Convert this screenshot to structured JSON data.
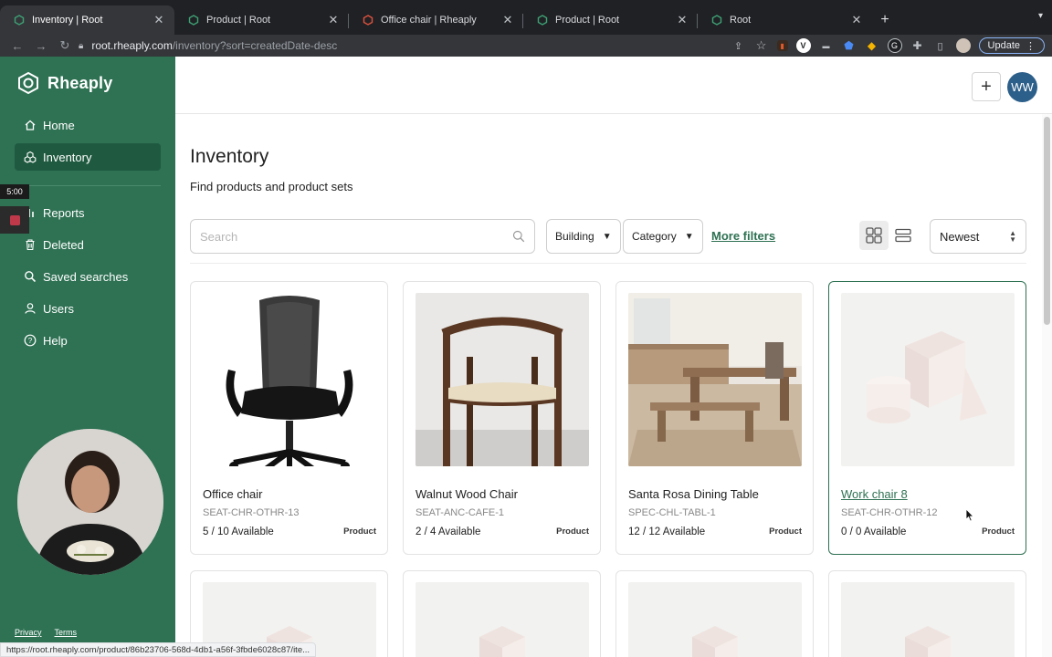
{
  "browser": {
    "tabs": [
      {
        "title": "Inventory | Root",
        "active": true
      },
      {
        "title": "Product | Root",
        "active": false
      },
      {
        "title": "Office chair | Rheaply",
        "active": false
      },
      {
        "title": "Product | Root",
        "active": false
      },
      {
        "title": "Root",
        "active": false
      }
    ],
    "url_host": "root.rheaply.com",
    "url_path": "/inventory?sort=createdDate-desc",
    "update_label": "Update",
    "status_url": "https://root.rheaply.com/product/86b23706-568d-4db1-a56f-3fbde6028c87/ite..."
  },
  "sidebar": {
    "brand": "Rheaply",
    "items": [
      {
        "label": "Home",
        "icon": "home-icon"
      },
      {
        "label": "Inventory",
        "icon": "inventory-icon"
      },
      {
        "label": "Reports",
        "icon": "bar-chart-icon"
      },
      {
        "label": "Deleted",
        "icon": "trash-icon"
      },
      {
        "label": "Saved searches",
        "icon": "search-icon"
      },
      {
        "label": "Users",
        "icon": "user-icon"
      },
      {
        "label": "Help",
        "icon": "help-icon"
      }
    ],
    "footer": {
      "privacy": "Privacy",
      "terms": "Terms"
    }
  },
  "recorder": {
    "time": "5:00"
  },
  "header": {
    "avatar_initials": "WW"
  },
  "page": {
    "title": "Inventory",
    "subtitle": "Find products and product sets"
  },
  "filters": {
    "search_placeholder": "Search",
    "building": "Building",
    "category": "Category",
    "more_filters": "More filters",
    "sort": "Newest"
  },
  "products": [
    {
      "name": "Office chair",
      "sku": "SEAT-CHR-OTHR-13",
      "availability": "5 / 10 Available",
      "type": "Product"
    },
    {
      "name": "Walnut Wood Chair",
      "sku": "SEAT-ANC-CAFE-1",
      "availability": "2 / 4 Available",
      "type": "Product"
    },
    {
      "name": "Santa Rosa Dining Table",
      "sku": "SPEC-CHL-TABL-1",
      "availability": "12 / 12 Available",
      "type": "Product"
    },
    {
      "name": "Work chair 8",
      "sku": "SEAT-CHR-OTHR-12",
      "availability": "0 / 0 Available",
      "type": "Product"
    }
  ],
  "colors": {
    "brand_green": "#2e7153",
    "sidebar_active": "#1f5a40",
    "avatar_blue": "#2c5f8a"
  }
}
